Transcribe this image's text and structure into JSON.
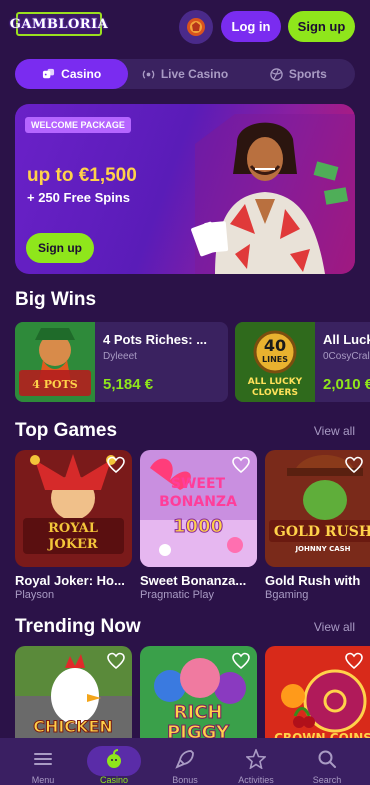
{
  "header": {
    "logo": "GAMBLORIA",
    "login_label": "Log in",
    "signup_label": "Sign up",
    "avatar_icon": "bonus-badge-icon"
  },
  "tabs": [
    {
      "label": "Casino",
      "icon": "dice-icon",
      "active": true
    },
    {
      "label": "Live Casino",
      "icon": "live-icon",
      "active": false
    },
    {
      "label": "Sports",
      "icon": "ball-icon",
      "active": false
    }
  ],
  "banner": {
    "badge": "WELCOME PACKAGE",
    "title": "up to €1,500",
    "subtitle": "+ 250 Free Spins",
    "button": "Sign up"
  },
  "big_wins": {
    "title": "Big Wins",
    "items": [
      {
        "game": "4 Pots Riches: ...",
        "user": "Dyleeet",
        "amount": "5,184 €",
        "thumb_text": "4 POTS RICHES"
      },
      {
        "game": "All Luck",
        "user": "0CosyCral",
        "amount": "2,010 €",
        "thumb_text": "40 LINES ALL LUCKY CLOVERS"
      }
    ]
  },
  "top_games": {
    "title": "Top Games",
    "view_all": "View all",
    "items": [
      {
        "name": "Royal Joker: Ho...",
        "provider": "Playson",
        "thumb_text": "ROYAL JOKER"
      },
      {
        "name": "Sweet Bonanza...",
        "provider": "Pragmatic Play",
        "thumb_text": "SWEET BONANZA 1000"
      },
      {
        "name": "Gold Rush with",
        "provider": "Bgaming",
        "thumb_text": "GOLD RUSH"
      }
    ]
  },
  "trending": {
    "title": "Trending Now",
    "view_all": "View all",
    "items": [
      {
        "thumb_text": "CHICKEN"
      },
      {
        "thumb_text": "RICH PIGGY"
      },
      {
        "thumb_text": "CROWN COINS"
      }
    ]
  },
  "bottom_nav": [
    {
      "label": "Menu",
      "icon": "menu-icon",
      "active": false
    },
    {
      "label": "Casino",
      "icon": "casino-apple-icon",
      "active": true
    },
    {
      "label": "Bonus",
      "icon": "rocket-icon",
      "active": false
    },
    {
      "label": "Activities",
      "icon": "activities-icon",
      "active": false
    },
    {
      "label": "Search",
      "icon": "search-icon",
      "active": false
    }
  ],
  "colors": {
    "background": "#2b1248",
    "accent_purple": "#7a2cf0",
    "accent_green": "#8fe61b",
    "card": "#3a2260",
    "muted_text": "#a99bc4"
  }
}
